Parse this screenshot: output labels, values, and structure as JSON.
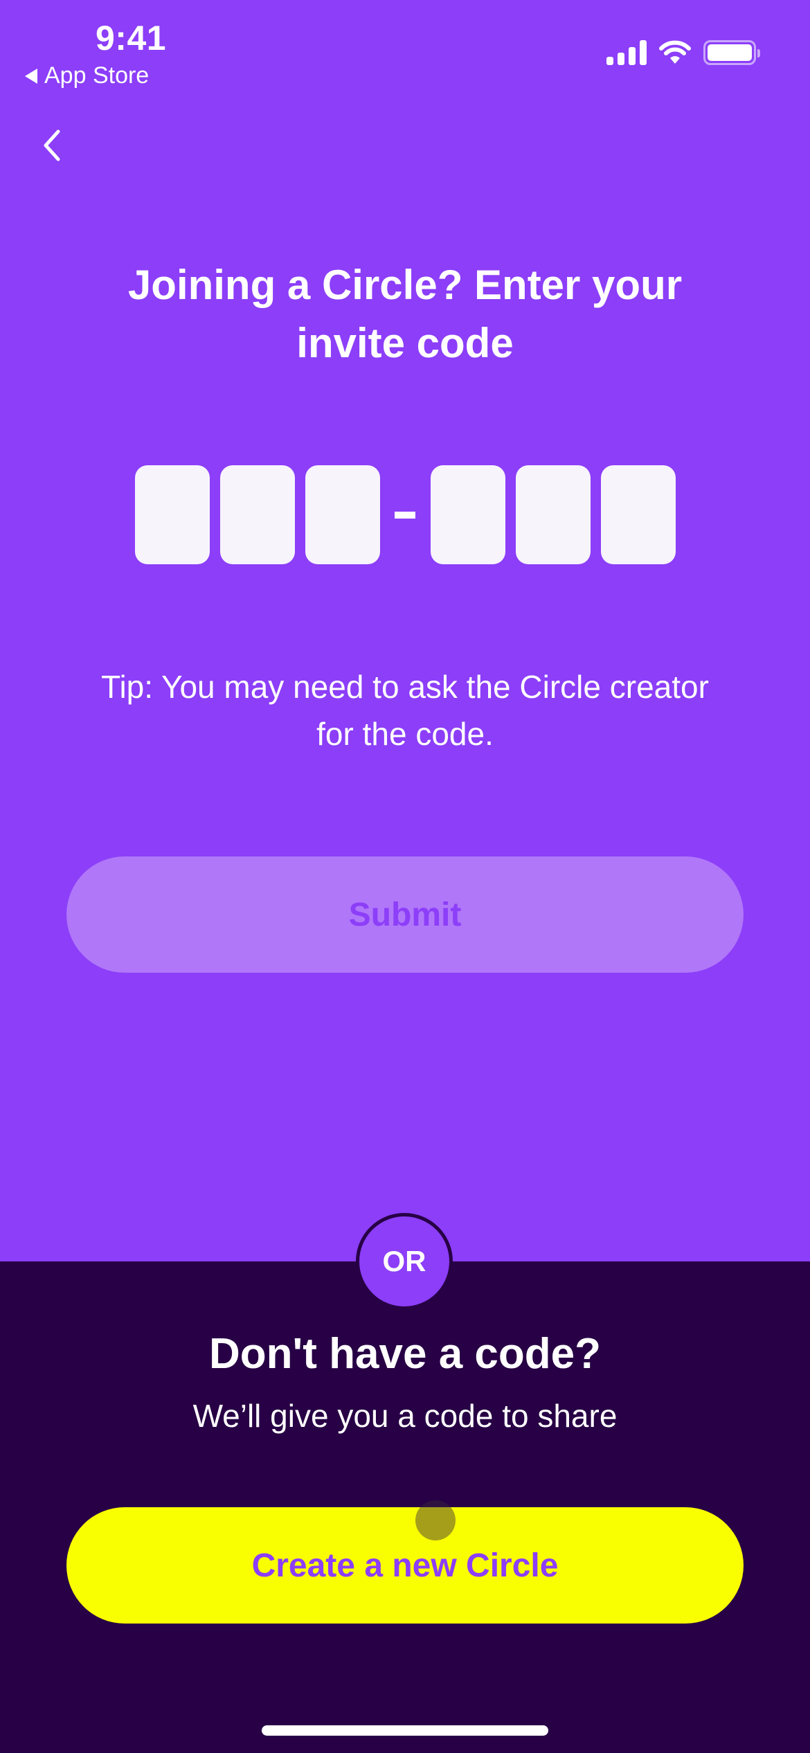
{
  "status_bar": {
    "time": "9:41",
    "back_app": "App Store",
    "icons": [
      "cellular-signal-icon",
      "wifi-icon",
      "battery-icon"
    ]
  },
  "nav": {
    "back_icon": "chevron-left-icon"
  },
  "join": {
    "heading": "Joining a Circle? Enter your invite code",
    "code_fields": [
      {
        "value": "",
        "placeholder": ""
      },
      {
        "value": "",
        "placeholder": ""
      },
      {
        "value": "",
        "placeholder": ""
      },
      {
        "value": "",
        "placeholder": ""
      },
      {
        "value": "",
        "placeholder": ""
      },
      {
        "value": "",
        "placeholder": ""
      }
    ],
    "separator": "-",
    "tip": "Tip: You may need to ask the Circle creator for the code.",
    "submit_label": "Submit",
    "submit_state": "disabled"
  },
  "divider": {
    "label": "OR"
  },
  "create": {
    "title": "Don't have a code?",
    "subtitle": "We’ll give you a code to share",
    "button_label": "Create a new Circle"
  },
  "colors": {
    "primary_purple": "#8c3ef8",
    "dark_purple": "#270045",
    "accent_yellow": "#f9ff00",
    "disabled_button": "#b077f9",
    "code_box": "#f8f4fc"
  }
}
